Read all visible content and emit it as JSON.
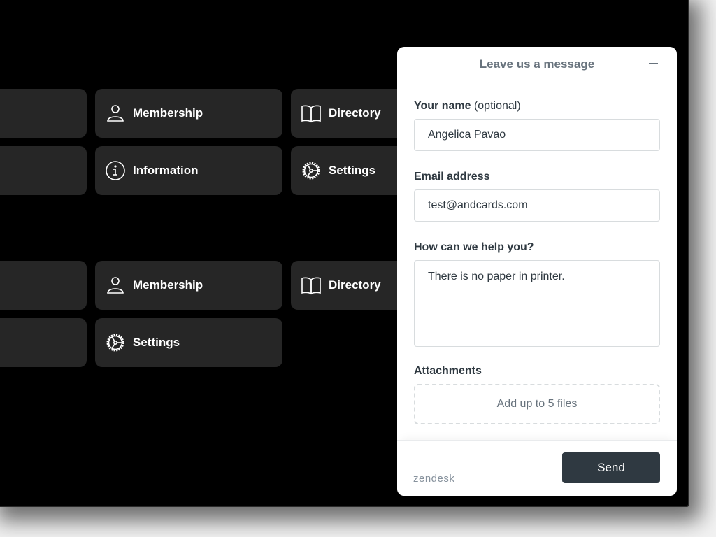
{
  "background_app": {
    "tiles": [
      {
        "label": "",
        "icon": "none"
      },
      {
        "label": "Membership",
        "icon": "person-icon"
      },
      {
        "label": "Directory",
        "icon": "book-icon"
      },
      {
        "label": "",
        "icon": "none"
      },
      {
        "label": "Information",
        "icon": "info-icon"
      },
      {
        "label": "Settings",
        "icon": "gear-icon"
      },
      {
        "label": "",
        "icon": "none"
      },
      {
        "label": "Membership",
        "icon": "person-icon"
      },
      {
        "label": "Directory",
        "icon": "book-icon"
      },
      {
        "label": "",
        "icon": "none"
      },
      {
        "label": "Settings",
        "icon": "gear-icon"
      }
    ]
  },
  "widget": {
    "title": "Leave us a message",
    "minimize_icon": "minus-icon",
    "fields": {
      "name": {
        "label": "Your name",
        "optional": "(optional)",
        "value": "Angelica Pavao"
      },
      "email": {
        "label": "Email address",
        "value": "test@andcards.com"
      },
      "message": {
        "label": "How can we help you?",
        "value": "There is no paper in printer."
      },
      "attachments": {
        "label": "Attachments",
        "dropzone_text": "Add up to 5 files"
      }
    },
    "footer": {
      "brand": "zendesk",
      "send_label": "Send"
    },
    "colors": {
      "primary_button": "#2f3941",
      "title": "#68737d",
      "border": "#d8dcde"
    }
  }
}
